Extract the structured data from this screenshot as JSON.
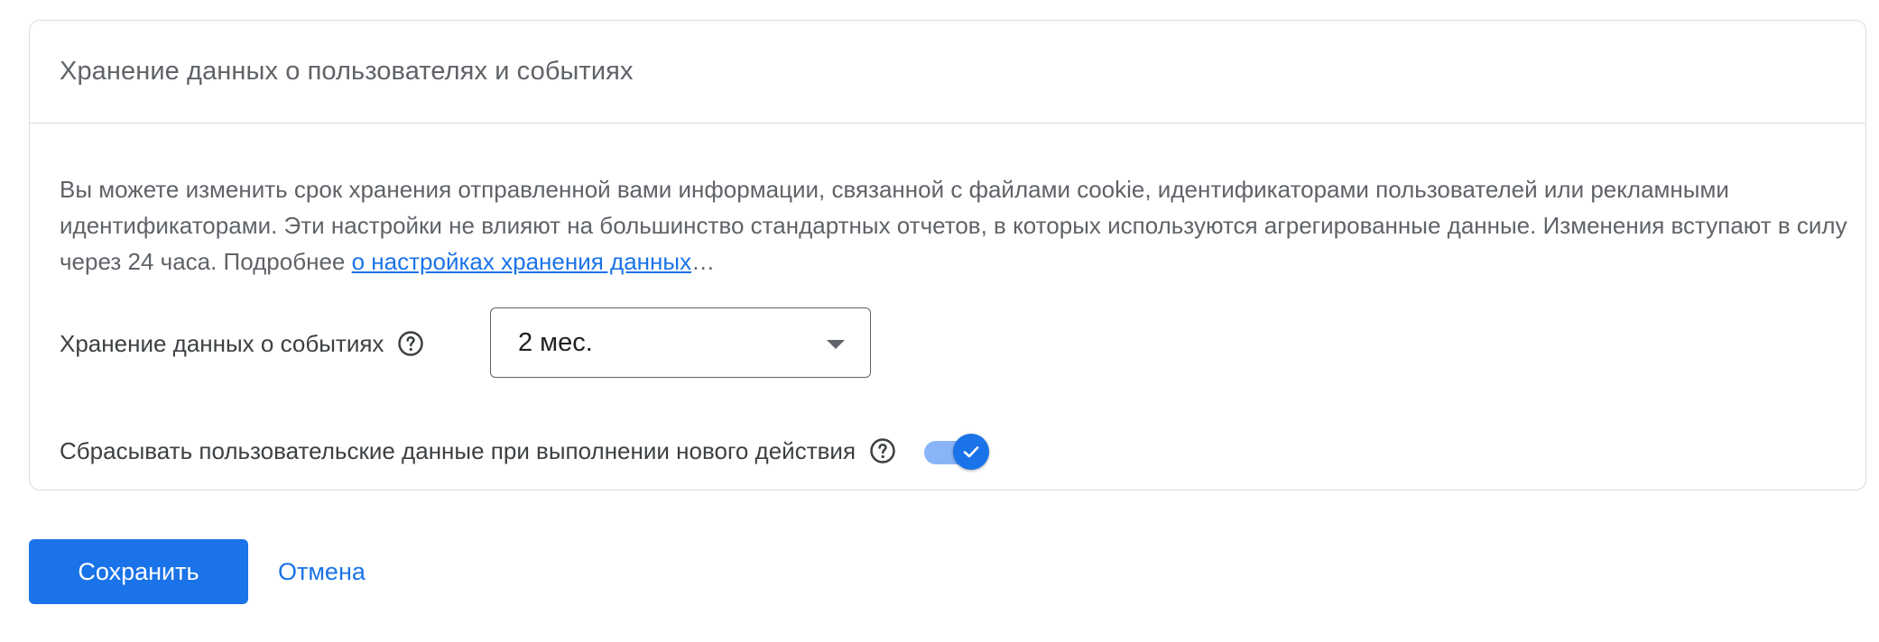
{
  "card": {
    "title": "Хранение данных о пользователях и событиях",
    "description": {
      "text": "Вы можете изменить срок хранения отправленной вами информации, связанной с файлами cookie, идентификаторами пользователей или рекламными идентификаторами. Эти настройки не влияют на большинство стандартных отчетов, в которых используются агрегированные данные. Изменения вступают в силу через 24 часа. Подробнее ",
      "link_text": "о настройках хранения данных",
      "ellipsis": "…"
    }
  },
  "event_retention": {
    "label": "Хранение данных о событиях",
    "help_icon": "help-circle-icon",
    "selected_value": "2 мес."
  },
  "reset_on_activity": {
    "label": "Сбрасывать пользовательские данные при выполнении нового действия",
    "help_icon": "help-circle-icon",
    "enabled": true
  },
  "actions": {
    "save_label": "Сохранить",
    "cancel_label": "Отмена"
  },
  "colors": {
    "accent": "#1a73e8",
    "toggle_track": "#8ab4f8",
    "border": "#dadce0",
    "text_secondary": "#5f6368"
  }
}
